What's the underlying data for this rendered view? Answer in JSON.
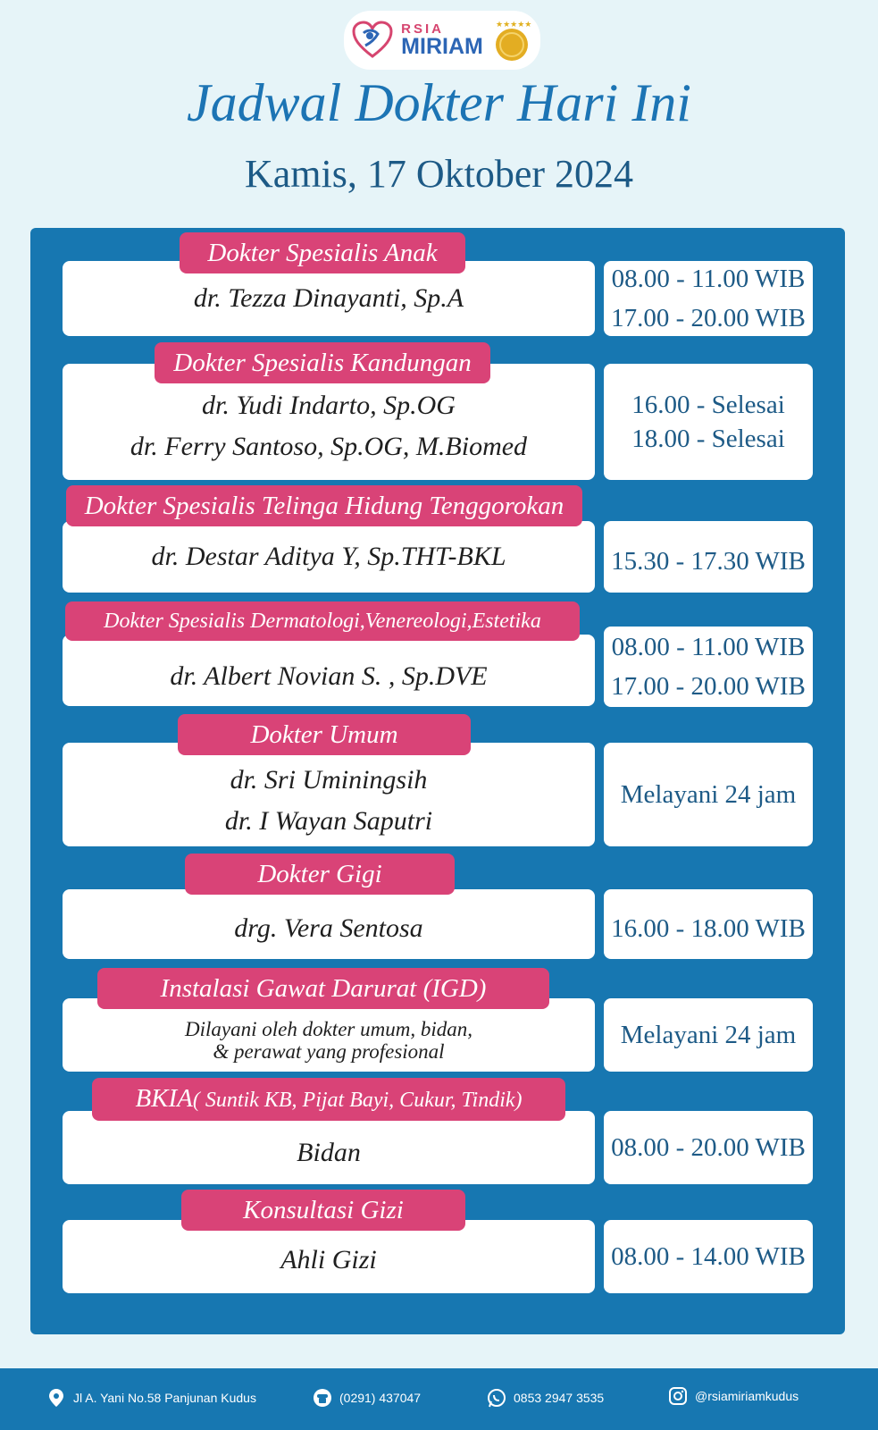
{
  "header": {
    "logo_small": "RSIA",
    "logo_name": "MIRIAM",
    "title": "Jadwal Dokter Hari Ini",
    "date": "Kamis, 17 Oktober 2024"
  },
  "colors": {
    "background": "#e6f4f8",
    "panel": "#1777b1",
    "label": "#d94377",
    "title": "#1c74b4"
  },
  "schedule": [
    {
      "label": "Dokter Spesialis Anak",
      "names": [
        "dr. Tezza Dinayanti, Sp.A"
      ],
      "times": [
        "08.00 - 11.00 WIB",
        "17.00 - 20.00 WIB"
      ]
    },
    {
      "label": "Dokter Spesialis Kandungan",
      "names": [
        "dr. Yudi Indarto, Sp.OG",
        "dr. Ferry Santoso, Sp.OG, M.Biomed"
      ],
      "times": [
        "16.00 - Selesai",
        "18.00 - Selesai"
      ]
    },
    {
      "label": "Dokter Spesialis Telinga Hidung Tenggorokan",
      "names": [
        "dr. Destar Aditya Y, Sp.THT-BKL"
      ],
      "times": [
        "15.30 - 17.30 WIB"
      ]
    },
    {
      "label": "Dokter Spesialis Dermatologi,Venereologi,Estetika",
      "names": [
        "dr. Albert Novian S. , Sp.DVE"
      ],
      "times": [
        "08.00 - 11.00 WIB",
        "17.00 - 20.00 WIB"
      ]
    },
    {
      "label": "Dokter Umum",
      "names": [
        "dr. Sri Uminingsih",
        "dr. I Wayan Saputri"
      ],
      "times": [
        "Melayani 24 jam"
      ]
    },
    {
      "label": "Dokter Gigi",
      "names": [
        "drg. Vera Sentosa"
      ],
      "times": [
        "16.00 - 18.00 WIB"
      ]
    },
    {
      "label": "Instalasi Gawat Darurat (IGD)",
      "names": [
        "Dilayani oleh dokter umum, bidan,",
        "& perawat yang profesional"
      ],
      "times": [
        "Melayani 24 jam"
      ]
    },
    {
      "label": "BKIA",
      "label_sub": "( Suntik KB, Pijat Bayi, Cukur, Tindik)",
      "names": [
        "Bidan"
      ],
      "times": [
        "08.00 - 20.00 WIB"
      ]
    },
    {
      "label": "Konsultasi Gizi",
      "names": [
        "Ahli Gizi"
      ],
      "times": [
        "08.00 - 14.00 WIB"
      ]
    }
  ],
  "footer": {
    "address": "Jl A. Yani No.58 Panjunan Kudus",
    "address_icon": "location-pin-icon",
    "phone": "(0291) 437047",
    "phone_icon": "phone-icon",
    "whatsapp": "0853 2947 3535",
    "whatsapp_icon": "whatsapp-icon",
    "instagram": "@rsiamiriamkudus",
    "instagram_icon": "instagram-icon"
  }
}
